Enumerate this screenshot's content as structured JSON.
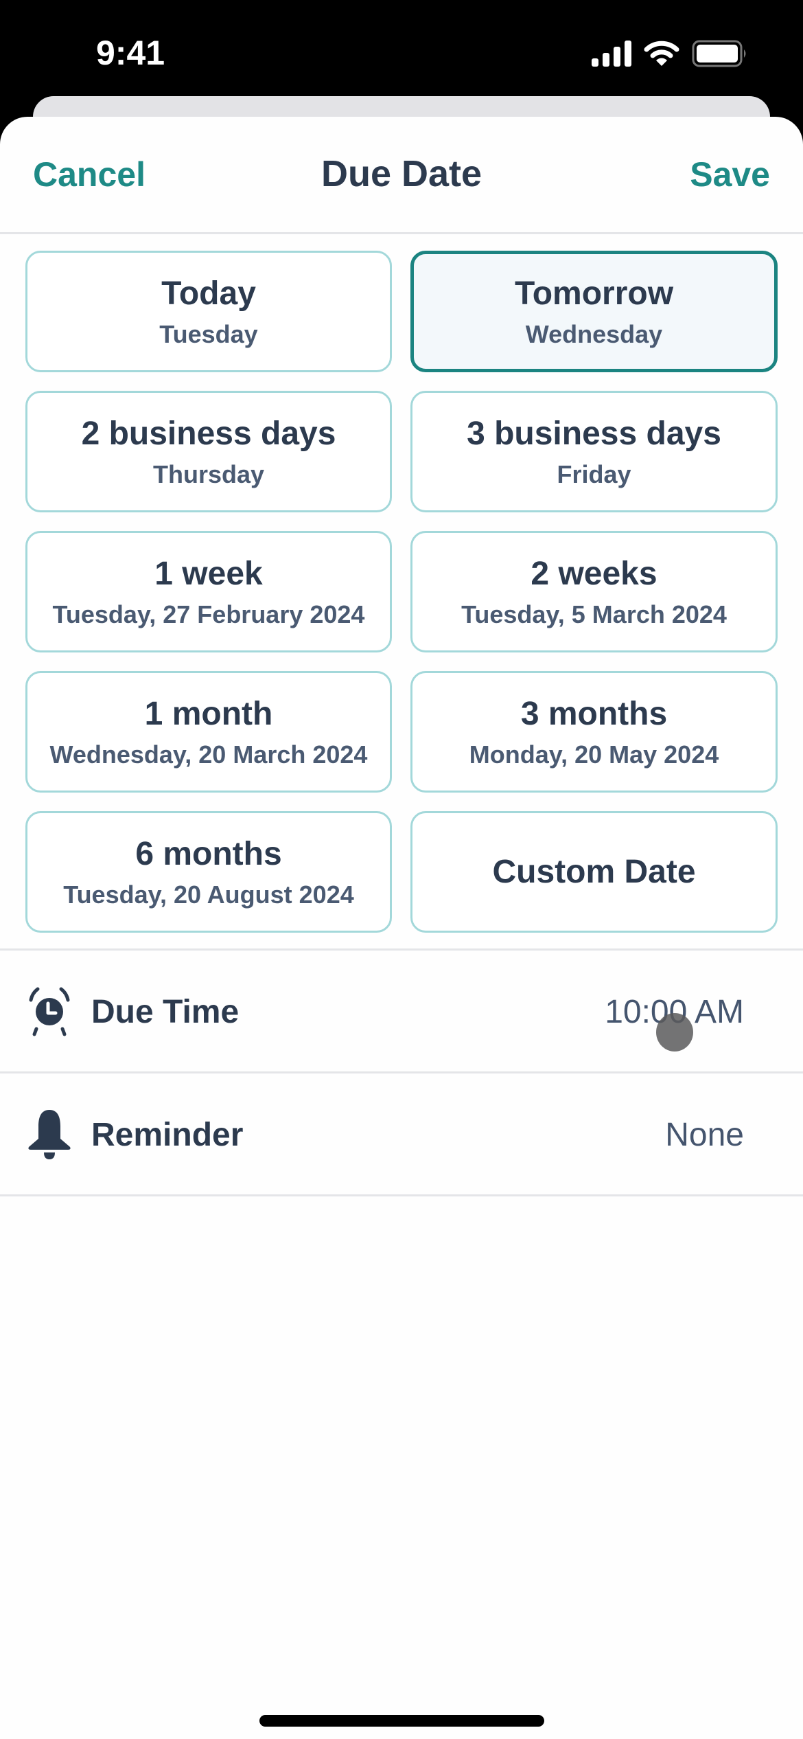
{
  "status_bar": {
    "time": "9:41",
    "icons": [
      "cellular-signal-icon",
      "wifi-icon",
      "battery-icon"
    ]
  },
  "header": {
    "cancel_label": "Cancel",
    "title": "Due Date",
    "save_label": "Save"
  },
  "colors": {
    "accent": "#1e8a86",
    "selected_border": "#1b8481",
    "card_border": "#a3d8da",
    "text_primary": "#2c3a4e",
    "text_secondary": "#4a5a72"
  },
  "date_options": [
    {
      "title": "Today",
      "subtitle": "Tuesday",
      "selected": false
    },
    {
      "title": "Tomorrow",
      "subtitle": "Wednesday",
      "selected": true
    },
    {
      "title": "2 business days",
      "subtitle": "Thursday",
      "selected": false
    },
    {
      "title": "3 business days",
      "subtitle": "Friday",
      "selected": false
    },
    {
      "title": "1 week",
      "subtitle": "Tuesday, 27 February 2024",
      "selected": false
    },
    {
      "title": "2 weeks",
      "subtitle": "Tuesday, 5 March 2024",
      "selected": false
    },
    {
      "title": "1 month",
      "subtitle": "Wednesday, 20 March 2024",
      "selected": false
    },
    {
      "title": "3 months",
      "subtitle": "Monday, 20 May 2024",
      "selected": false
    },
    {
      "title": "6 months",
      "subtitle": "Tuesday, 20 August 2024",
      "selected": false
    },
    {
      "title": "Custom Date",
      "subtitle": "",
      "selected": false
    }
  ],
  "settings": {
    "due_time": {
      "label": "Due Time",
      "value": "10:00 AM",
      "icon": "alarm-clock-icon"
    },
    "reminder": {
      "label": "Reminder",
      "value": "None",
      "icon": "bell-icon"
    }
  }
}
